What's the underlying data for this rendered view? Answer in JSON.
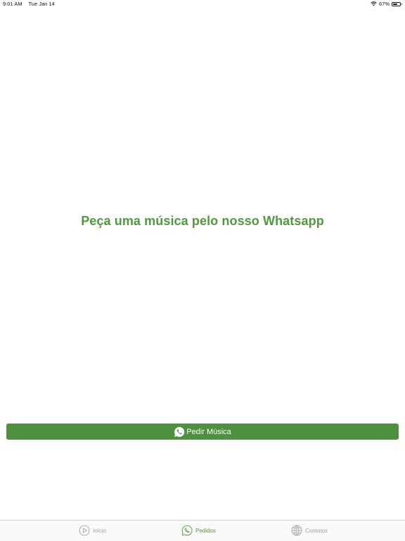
{
  "status_bar": {
    "time": "9:01 AM",
    "date": "Tue Jan 14",
    "battery_percent": "67%",
    "battery_level": 0.67,
    "wifi_icon": "wifi-icon"
  },
  "main": {
    "headline": "Peça uma música pelo nosso Whatsapp",
    "request_button": {
      "label": "Pedir Música",
      "icon": "whatsapp-icon"
    }
  },
  "tab_bar": {
    "items": [
      {
        "label": "Início",
        "icon": "play-circle-icon",
        "active": false
      },
      {
        "label": "Pedidos",
        "icon": "whatsapp-icon",
        "active": true
      },
      {
        "label": "Contatos",
        "icon": "globe-icon",
        "active": false
      }
    ]
  },
  "colors": {
    "accent": "#4e9a3c",
    "button": "#4e8f40",
    "inactive": "#a0a0a0"
  }
}
